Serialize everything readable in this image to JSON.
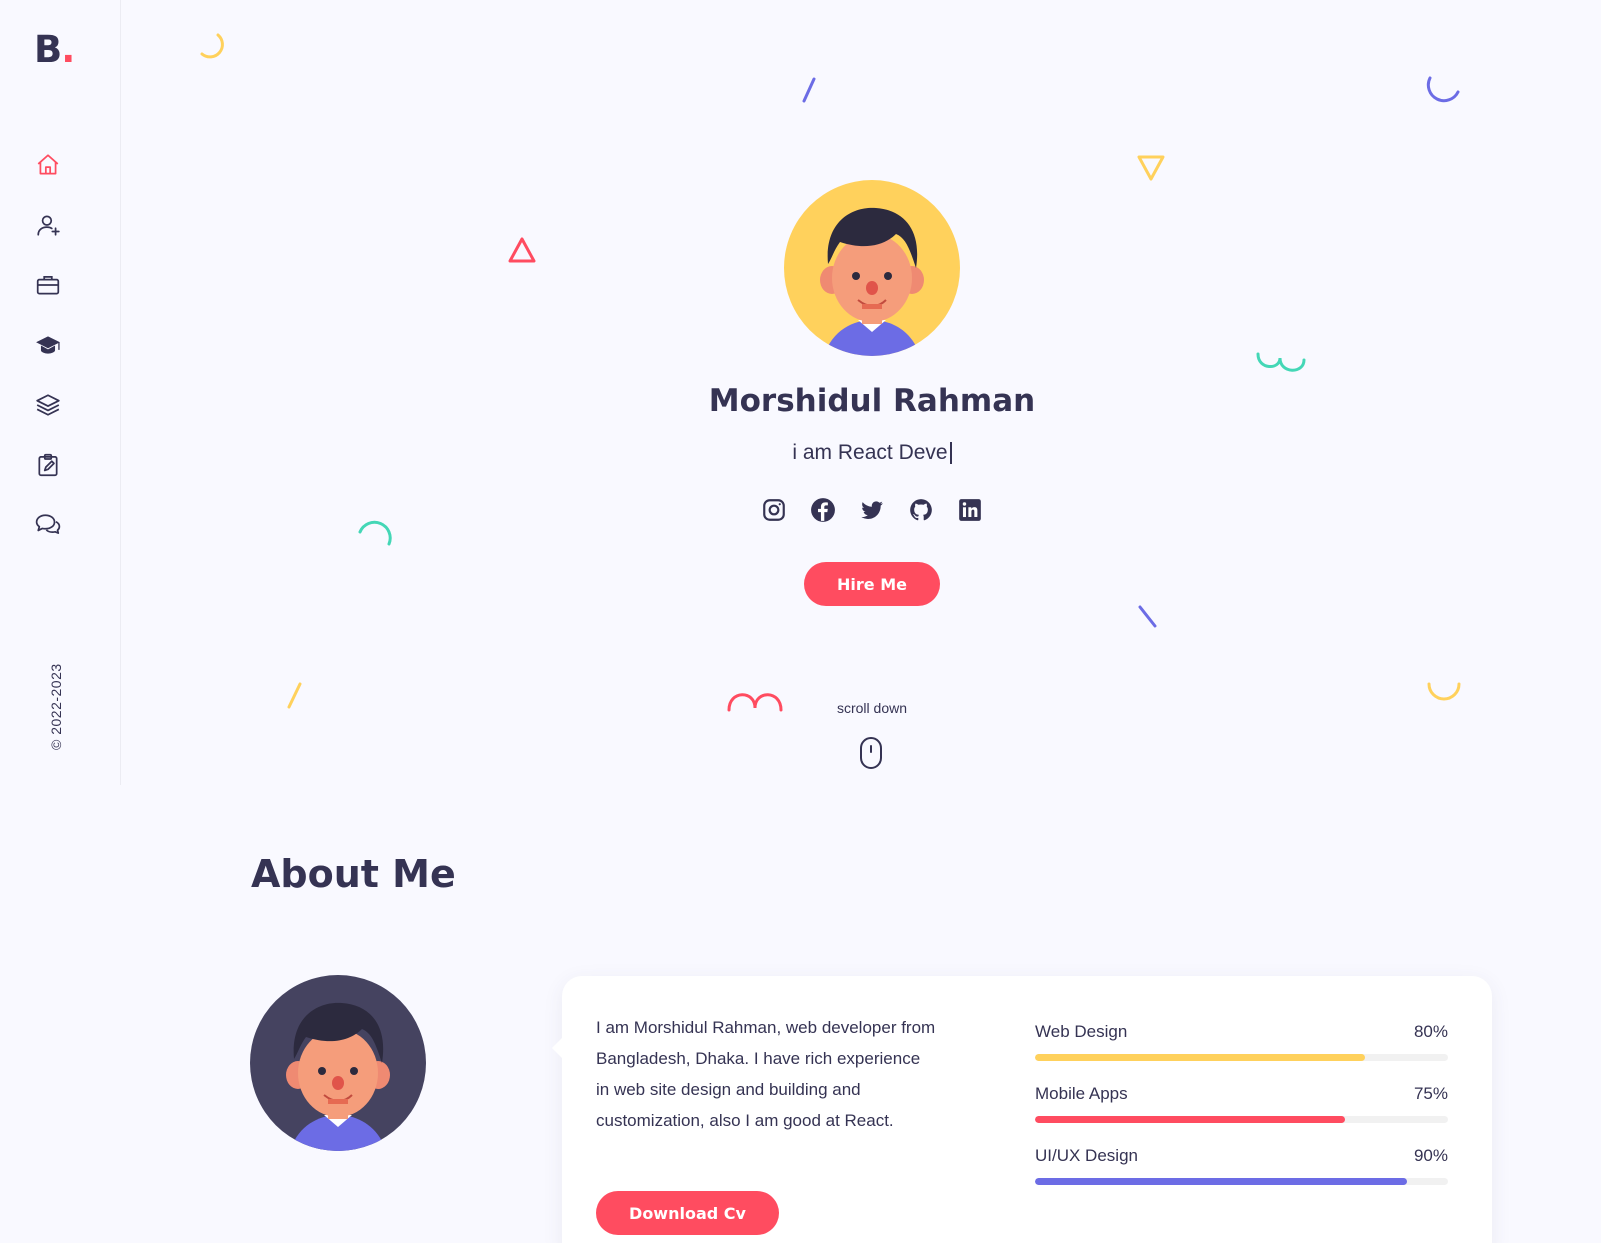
{
  "brand": {
    "logo_letter": "B",
    "logo_dot": ".",
    "accent": "#ff4c60"
  },
  "sidebar": {
    "items": [
      {
        "icon": "home-icon",
        "active": true
      },
      {
        "icon": "user-plus-icon"
      },
      {
        "icon": "briefcase-icon"
      },
      {
        "icon": "graduation-cap-icon"
      },
      {
        "icon": "layers-icon"
      },
      {
        "icon": "clipboard-edit-icon"
      },
      {
        "icon": "chat-bubbles-icon"
      }
    ],
    "copyright": "© 2022-2023"
  },
  "hero": {
    "name": "Morshidul Rahman",
    "subtitle": "i am  React Deve",
    "socials": [
      "instagram-icon",
      "facebook-icon",
      "twitter-icon",
      "github-icon",
      "linkedin-icon"
    ],
    "hire_label": "Hire Me",
    "scroll_label": "scroll down"
  },
  "about": {
    "title": "About Me",
    "text": "I am Morshidul Rahman, web developer from Bangladesh, Dhaka. I have rich experience in web site design and building and customization, also I am good at React.",
    "cv_label": "Download Cv",
    "skills": [
      {
        "name": "Web Design",
        "percent": "80%",
        "value": 80,
        "color": "#ffd15c"
      },
      {
        "name": "Mobile Apps",
        "percent": "75%",
        "value": 75,
        "color": "#ff4c60"
      },
      {
        "name": "UI/UX Design",
        "percent": "90%",
        "value": 90,
        "color": "#6c6ce5"
      }
    ]
  },
  "colors": {
    "yellow": "#ffd15c",
    "red": "#ff4c60",
    "purple": "#6c6ce5",
    "green": "#44d7b6",
    "dark": "#353353"
  }
}
